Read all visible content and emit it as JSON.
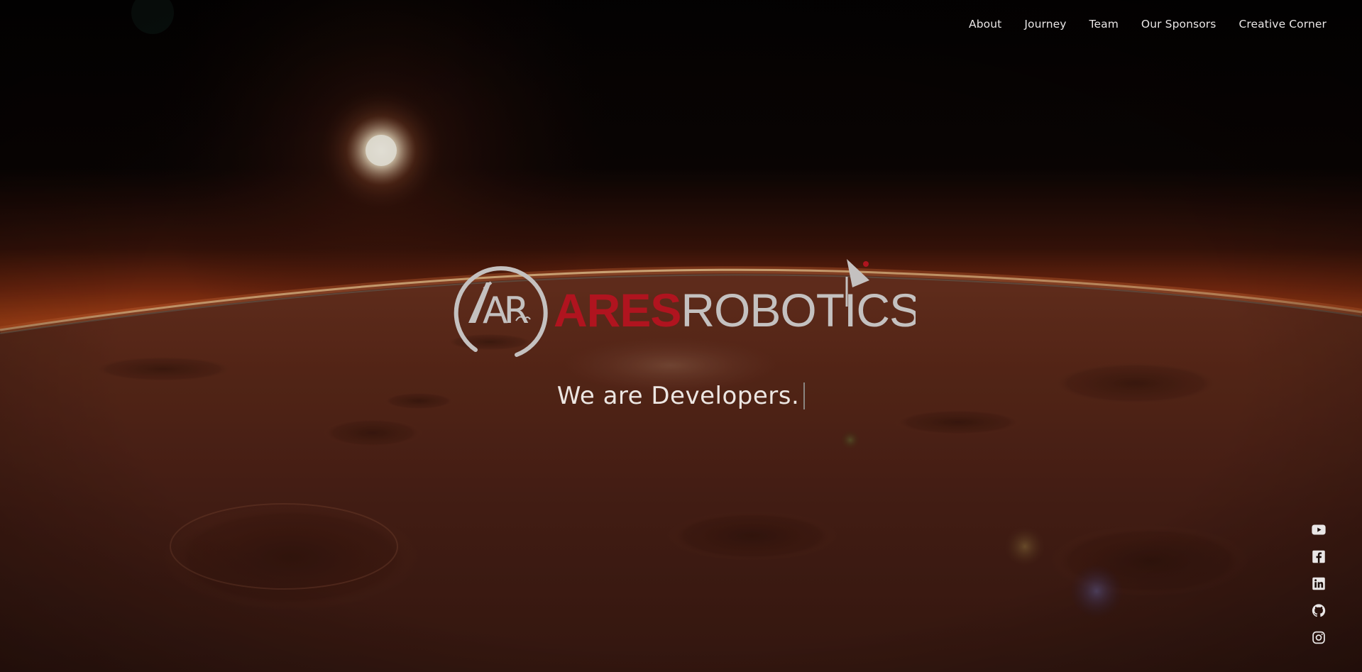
{
  "nav": {
    "items": [
      {
        "label": "About"
      },
      {
        "label": "Journey"
      },
      {
        "label": "Team"
      },
      {
        "label": "Our Sponsors"
      },
      {
        "label": "Creative Corner"
      }
    ]
  },
  "brand": {
    "monogram": "AR",
    "word_red": "ARES",
    "word_gray": "ROBOTICS",
    "red_color": "#b0141f",
    "gray_color": "#c4c1c0"
  },
  "hero": {
    "tagline": "We are Developers."
  },
  "social": {
    "icons": [
      "youtube-icon",
      "facebook-icon",
      "linkedin-icon",
      "github-icon",
      "instagram-icon"
    ]
  }
}
